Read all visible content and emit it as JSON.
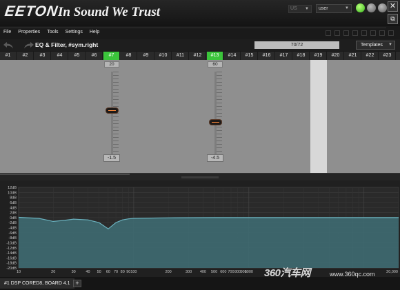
{
  "header": {
    "logo_main": "EETON",
    "logo_tagline": "In Sound We Trust",
    "lang_select": "US",
    "user_select": "user"
  },
  "menu": [
    "File",
    "Properties",
    "Tools",
    "Settings",
    "Help"
  ],
  "presetbar": {
    "title": "EQ & Filter, #sym.right",
    "counter": "70/72",
    "templates_label": "Templates"
  },
  "channels": [
    "#1",
    "#2",
    "#3",
    "#4",
    "#5",
    "#6",
    "#7",
    "#8",
    "#9",
    "#10",
    "#11",
    "#12",
    "#13",
    "#14",
    "#15",
    "#16",
    "#17",
    "#18",
    "#19",
    "#20",
    "#21",
    "#22",
    "#23"
  ],
  "active_channels": [
    "#7",
    "#13"
  ],
  "highlight_band": "#19",
  "bands": [
    {
      "channel": "#7",
      "freq": "20",
      "gain": "-1.5",
      "level": 0.53
    },
    {
      "channel": "#13",
      "freq": "60",
      "gain": "-4.5",
      "level": 0.38
    }
  ],
  "chart_data": {
    "type": "line",
    "series": [
      {
        "x": [
          10,
          15,
          20,
          25,
          30,
          40,
          50,
          60,
          70,
          80,
          90,
          100,
          200,
          500,
          1000,
          5000,
          20000
        ],
        "y": [
          0.1,
          -0.3,
          -1.5,
          -1.1,
          -0.6,
          -0.9,
          -2.0,
          -4.5,
          -2.0,
          -0.9,
          -0.5,
          -0.3,
          -0.1,
          0,
          0,
          0,
          0
        ]
      }
    ],
    "y_tick_labels": [
      "12dB",
      "10dB",
      "8dB",
      "6dB",
      "4dB",
      "2dB",
      "0dB",
      "-2dB",
      "-4dB",
      "-6dB",
      "-8dB",
      "-10dB",
      "-12dB",
      "-14dB",
      "-16dB",
      "-18dB",
      "-20dB"
    ],
    "y_tick_values": [
      12,
      10,
      8,
      6,
      4,
      2,
      0,
      -2,
      -4,
      -6,
      -8,
      -10,
      -12,
      -14,
      -16,
      -18,
      -20
    ],
    "x_tick_labels": [
      "10",
      "20",
      "30",
      "40",
      "50",
      "60",
      "70",
      "80",
      "90",
      "100",
      "200",
      "300",
      "400",
      "500",
      "600",
      "700",
      "800",
      "900",
      "1000"
    ],
    "x_tick_values": [
      10,
      20,
      30,
      40,
      50,
      60,
      70,
      80,
      90,
      100,
      200,
      300,
      400,
      500,
      600,
      700,
      800,
      900,
      1000
    ],
    "x_tick_labels_right": [
      "20,000"
    ],
    "x_tick_values_right": [
      20000
    ],
    "xlim": [
      10,
      20000
    ],
    "ylim": [
      -20,
      12
    ],
    "x_scale": "log",
    "grid": true,
    "line_color": "#6bb3c0",
    "fill_color": "#3f6e76"
  },
  "footer": {
    "device_tab": "#1 DSP CORED8, BOARD 4.1",
    "add_tab": "+"
  },
  "watermark": {
    "brand": "360汽车网",
    "url": "www.360qc.com"
  },
  "colors": {
    "active_tab": "#3bc53b",
    "highlight_band": "#d8d8d8",
    "knob_accent": "#ff8a3a"
  }
}
